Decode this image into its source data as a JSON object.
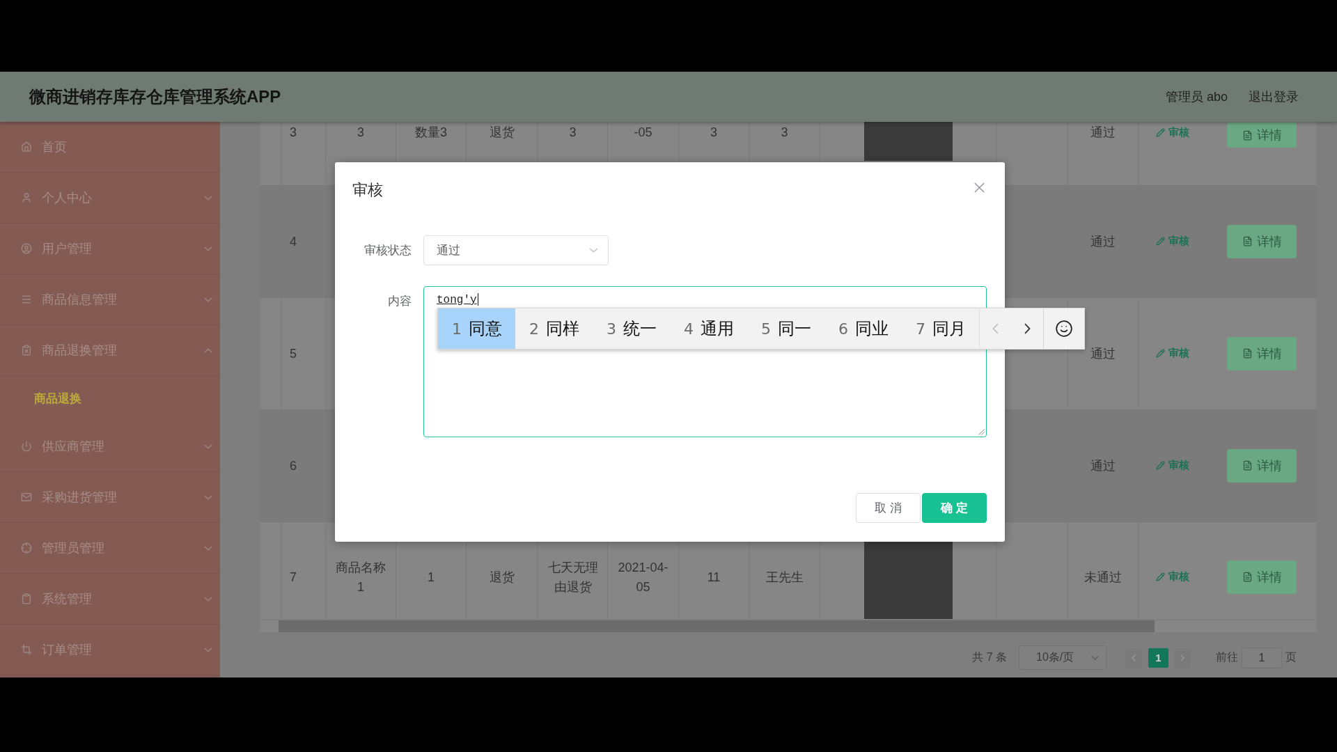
{
  "header": {
    "title": "微商进销存库存仓库管理系统APP",
    "user": "管理员 abo",
    "logout": "退出登录"
  },
  "sidebar": {
    "items": [
      {
        "kind": "link",
        "label": "首页"
      },
      {
        "kind": "menu",
        "label": "个人中心",
        "expanded": false
      },
      {
        "kind": "menu",
        "label": "用户管理",
        "expanded": false
      },
      {
        "kind": "menu",
        "label": "商品信息管理",
        "expanded": false
      },
      {
        "kind": "menu",
        "label": "商品退换管理",
        "expanded": true,
        "children": [
          {
            "label": "商品退换",
            "selected": true
          }
        ]
      },
      {
        "kind": "menu",
        "label": "供应商管理",
        "expanded": false
      },
      {
        "kind": "menu",
        "label": "采购进货管理",
        "expanded": false
      },
      {
        "kind": "menu",
        "label": "管理员管理",
        "expanded": false
      },
      {
        "kind": "menu",
        "label": "系统管理",
        "expanded": false
      },
      {
        "kind": "menu",
        "label": "订单管理",
        "expanded": false
      }
    ]
  },
  "table": {
    "rows": [
      {
        "kind": "cut",
        "index": "3",
        "cells": [
          "3",
          "数量3",
          "退货",
          "3",
          "-05",
          "3",
          "3"
        ],
        "photo": true,
        "status": "通过",
        "review": "审核",
        "details": "详情"
      },
      {
        "kind": "full",
        "index": "4",
        "status": "通过",
        "review": "审核",
        "details": "详情"
      },
      {
        "kind": "full",
        "index": "5",
        "status": "通过",
        "review": "审核",
        "details": "详情"
      },
      {
        "kind": "full",
        "index": "6",
        "status": "通过",
        "review": "审核",
        "details": "详情"
      },
      {
        "kind": "full",
        "index": "7",
        "cells": [
          "商品名称1",
          "1",
          "退货",
          "七天无理由退货",
          "2021-04-05",
          "11",
          "王先生"
        ],
        "photo": true,
        "status": "未通过",
        "review": "审核",
        "details": "详情"
      }
    ]
  },
  "pagination": {
    "total": "共 7 条",
    "page_size": "10条/页",
    "pages": [
      {
        "label": "1",
        "selected": true
      }
    ],
    "goto_label": "前往",
    "goto_value": "1",
    "goto_suffix": "页"
  },
  "dialog": {
    "title": "审核",
    "fields": [
      {
        "kind": "select",
        "label": "审核状态",
        "value": "通过"
      },
      {
        "kind": "textarea",
        "label": "内容",
        "value": "tong'y",
        "focused": true,
        "composing": true
      }
    ],
    "ime": {
      "candidates": [
        {
          "number": "1",
          "text": "同意",
          "selected": true
        },
        {
          "number": "2",
          "text": "同样",
          "selected": false
        },
        {
          "number": "3",
          "text": "统一",
          "selected": false
        },
        {
          "number": "4",
          "text": "通用",
          "selected": false
        },
        {
          "number": "5",
          "text": "同一",
          "selected": false
        },
        {
          "number": "6",
          "text": "同业",
          "selected": false
        },
        {
          "number": "7",
          "text": "同月",
          "selected": false
        }
      ],
      "prev_disabled": true,
      "next_disabled": false
    },
    "buttons": [
      {
        "label": "取 消",
        "primary": false
      },
      {
        "label": "确 定",
        "primary": true
      }
    ]
  }
}
